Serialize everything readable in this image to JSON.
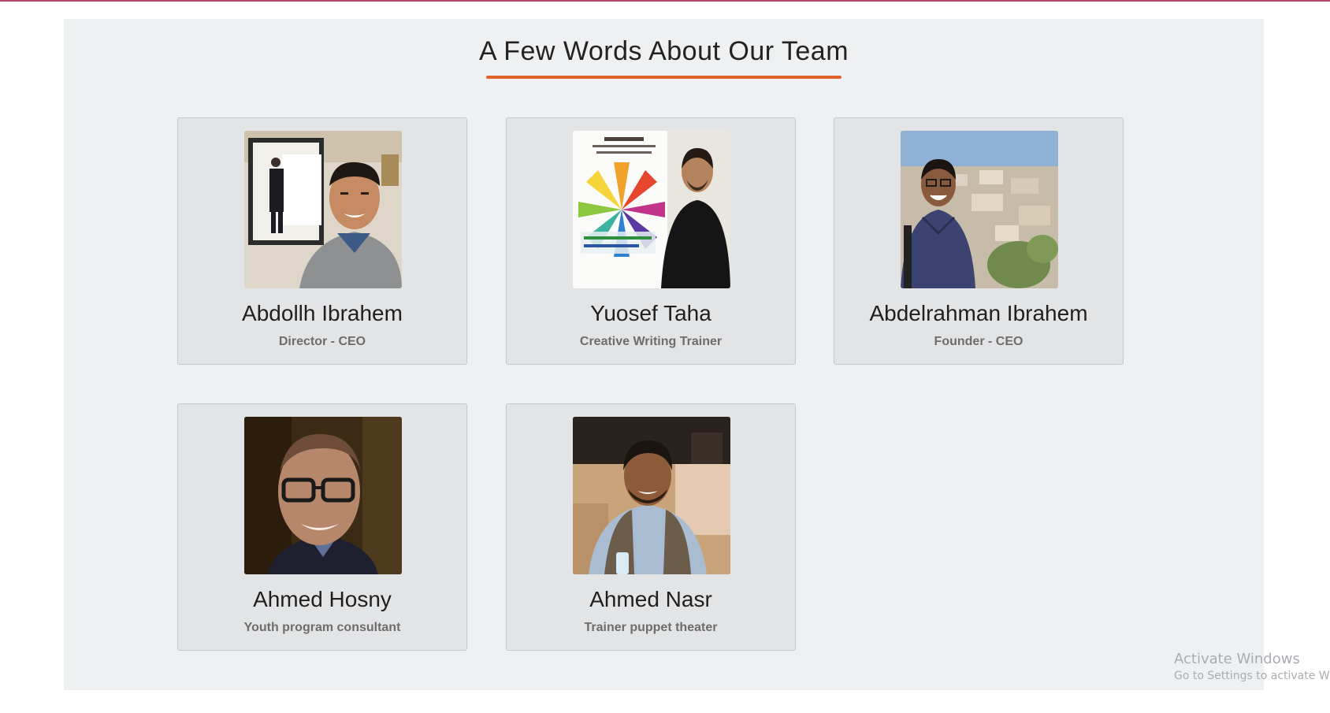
{
  "section": {
    "title": "A Few Words About Our Team",
    "accent_color": "#e0632b"
  },
  "team": [
    {
      "name": "Abdollh Ibrahem",
      "role": "Director - CEO",
      "photo_icon": "person-photo"
    },
    {
      "name": "Yuosef Taha",
      "role": "Creative Writing Trainer",
      "photo_icon": "person-photo"
    },
    {
      "name": "Abdelrahman Ibrahem",
      "role": "Founder - CEO",
      "photo_icon": "person-photo"
    },
    {
      "name": "Ahmed Hosny",
      "role": "Youth program consultant",
      "photo_icon": "person-photo"
    },
    {
      "name": "Ahmed Nasr",
      "role": "Trainer puppet theater",
      "photo_icon": "person-photo"
    }
  ],
  "watermark": {
    "title": "Activate Windows",
    "subtitle": "Go to Settings to activate Win"
  }
}
